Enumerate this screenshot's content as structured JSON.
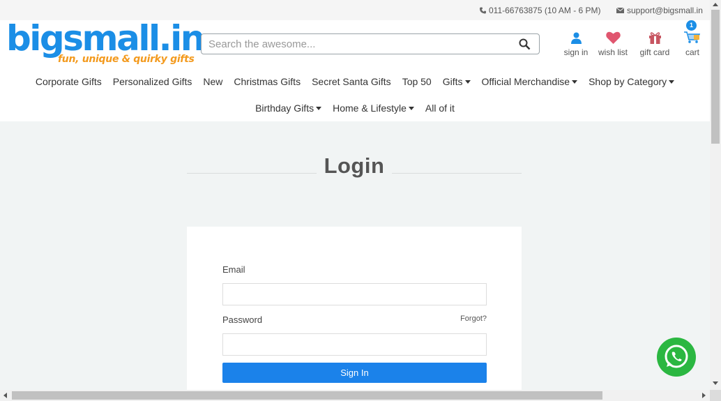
{
  "topbar": {
    "phone": "011-66763875 (10 AM - 6 PM)",
    "email": "support@bigsmall.in"
  },
  "logo": {
    "name": "bigsmall.in",
    "tagline": "fun, unique & quirky gifts"
  },
  "search": {
    "placeholder": "Search the awesome..."
  },
  "header_icons": {
    "signin": "sign in",
    "wishlist": "wish list",
    "giftcard": "gift card",
    "cart": "cart",
    "cart_count": "1"
  },
  "nav": {
    "row1": [
      {
        "label": "Corporate Gifts",
        "dropdown": false
      },
      {
        "label": "Personalized Gifts",
        "dropdown": false
      },
      {
        "label": "New",
        "dropdown": false
      },
      {
        "label": "Christmas Gifts",
        "dropdown": false
      },
      {
        "label": "Secret Santa Gifts",
        "dropdown": false
      },
      {
        "label": "Top 50",
        "dropdown": false
      },
      {
        "label": "Gifts",
        "dropdown": true
      },
      {
        "label": "Official Merchandise",
        "dropdown": true
      },
      {
        "label": "Shop by Category",
        "dropdown": true
      }
    ],
    "row2": [
      {
        "label": "Birthday Gifts",
        "dropdown": true
      },
      {
        "label": "Home & Lifestyle",
        "dropdown": true
      },
      {
        "label": "All of it",
        "dropdown": false
      }
    ]
  },
  "login": {
    "title": "Login",
    "email_label": "Email",
    "email_value": "",
    "password_label": "Password",
    "password_value": "",
    "forgot": "Forgot?",
    "signin_button": "Sign In"
  },
  "colors": {
    "brand_blue": "#1b8ee6",
    "brand_orange": "#f39a1e",
    "button_blue": "#1b82ea",
    "whatsapp_green": "#2bb741",
    "wishlist_pink": "#e0566f",
    "giftcard_red": "#c75561"
  }
}
